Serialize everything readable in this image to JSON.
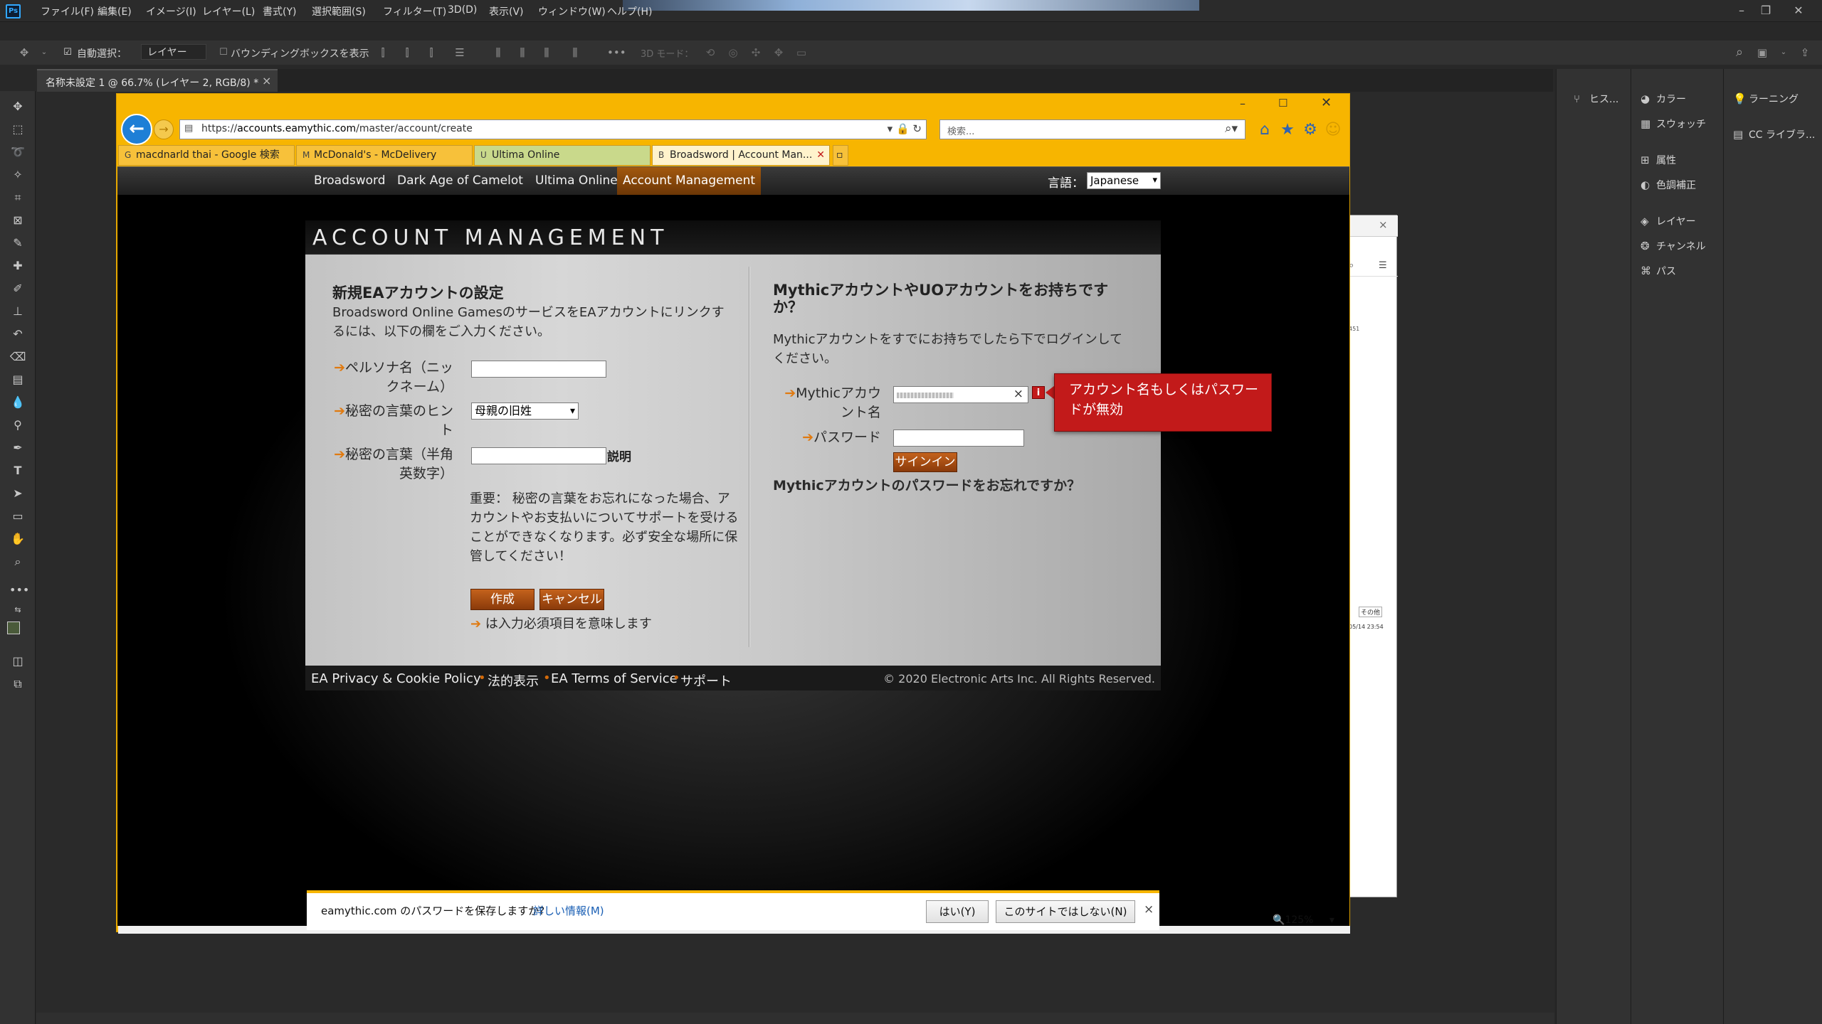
{
  "ps": {
    "logo": "Ps",
    "menu": [
      "ファイル(F)",
      "編集(E)",
      "イメージ(I)",
      "レイヤー(L)",
      "書式(Y)",
      "選択範囲(S)",
      "フィルター(T)",
      "3D(D)",
      "表示(V)",
      "ウィンドウ(W)",
      "ヘルプ(H)"
    ],
    "options": {
      "auto_select_label": "自動選択：",
      "auto_select_value": "レイヤー",
      "bbox_label": "バウンディングボックスを表示",
      "mode_3d": "3D モード："
    },
    "doc_tab": "名称未設定 1 @ 66.7% (レイヤー 2, RGB/8) *",
    "panels": {
      "col1": [
        "ヒス..."
      ],
      "col2": [
        "カラー",
        "スウォッチ",
        "属性",
        "色調補正",
        "レイヤー",
        "チャンネル",
        "パス"
      ],
      "col3": [
        "ラーニング",
        "CC ライブラ..."
      ]
    },
    "bg_window_text": [
      "その他",
      "05/14 23:54",
      "451"
    ]
  },
  "browser": {
    "url_prefix": "https://",
    "url_host": "accounts.eamythic.com",
    "url_path": "/master/account/create",
    "search_placeholder": "検索...",
    "tabs": [
      {
        "title": "macdnarld thai - Google 検索",
        "favicon": "G"
      },
      {
        "title": "McDonald's - McDelivery",
        "favicon": "M"
      },
      {
        "title": "Ultima Online",
        "favicon": "U"
      },
      {
        "title": "Broadsword | Account Man...",
        "favicon": "B"
      }
    ],
    "zoom": "125%"
  },
  "site": {
    "nav": [
      "Broadsword",
      "Dark Age of Camelot",
      "Ultima Online",
      "Account Management"
    ],
    "lang_label": "言語：",
    "lang_value": "Japanese",
    "title": "ACCOUNT MANAGEMENT",
    "left": {
      "heading": "新規EAアカウントの設定",
      "intro": "Broadsword Online GamesのサービスをEAアカウントにリンクするには、以下の欄をご入力ください。",
      "persona_label": "ペルソナ名（ニックネーム）",
      "hint_label": "秘密の言葉のヒント",
      "hint_value": "母親の旧姓",
      "secret_label": "秘密の言葉（半角英数字）",
      "explain_link": "説明",
      "notice": "重要： 秘密の言葉をお忘れになった場合、アカウントやお支払いについてサポートを受けることができなくなります。必ず安全な場所に保管してください！",
      "create_button": "作成",
      "cancel_button": "キャンセル",
      "required_note": "は入力必須項目を意味します"
    },
    "right": {
      "heading": "MythicアカウントやUOアカウントをお持ちですか？",
      "intro": "Mythicアカウントをすでにお持ちでしたら下でログインしてください。",
      "account_label": "Mythicアカウント名",
      "password_label": "パスワード",
      "signin_button": "サインイン",
      "forgot_link": "Mythicアカウントのパスワードをお忘れですか？",
      "error_tip": "アカウント名もしくはパスワードが無効"
    },
    "footer": {
      "links": [
        "EA Privacy & Cookie Policy",
        "法的表示",
        "EA Terms of Service",
        "サポート"
      ],
      "copyright": "© 2020 Electronic Arts Inc. All Rights Reserved."
    }
  },
  "pwbar": {
    "message": "eamythic.com のパスワードを保存しますか?",
    "more_info": "詳しい情報(M)",
    "yes": "はい(Y)",
    "never": "このサイトではしない(N)"
  }
}
